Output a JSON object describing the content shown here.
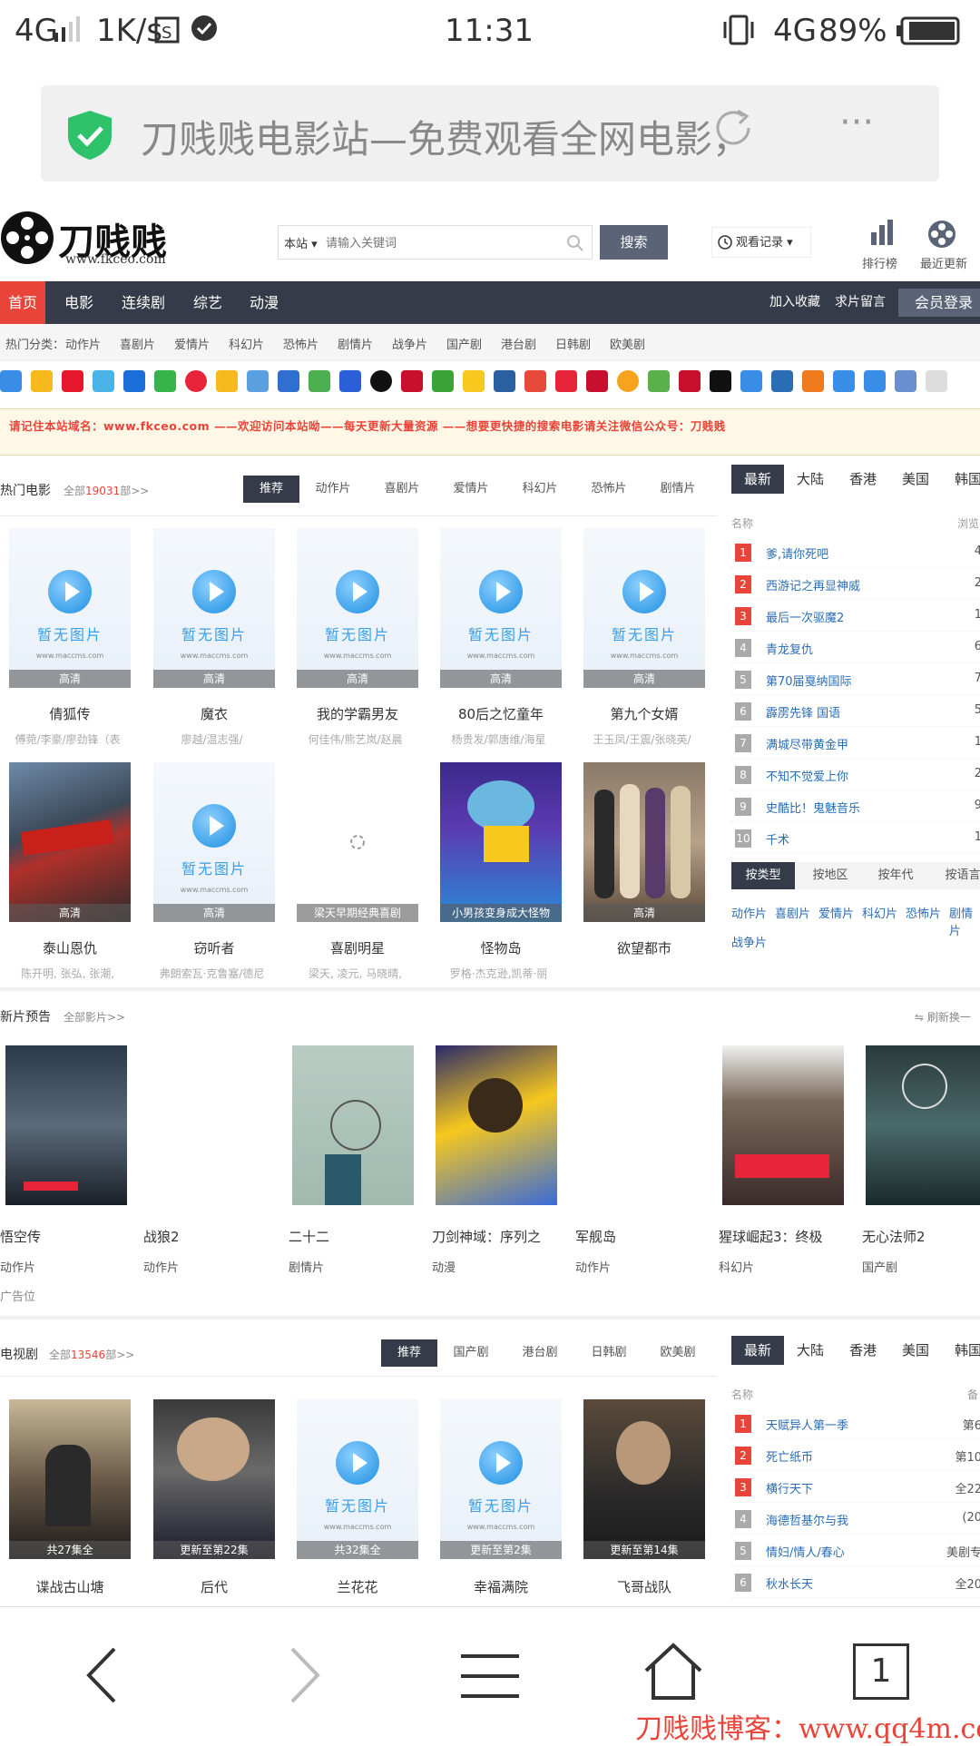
{
  "status_bar": {
    "network": "4G",
    "speed": "1K/s",
    "time": "11:31",
    "network_right": "4G",
    "battery": "89%"
  },
  "address_bar": {
    "title": "刀贱贱电影站—免费观看全网电影，",
    "more": "···"
  },
  "header": {
    "logo_text": "刀贱贱",
    "logo_url": "www.fkceo.com",
    "search_scope": "本站",
    "search_placeholder": "请输入关键词",
    "search_button": "搜索",
    "history_label": "观看记录",
    "rank_label": "排行榜",
    "recent_label": "最近更新"
  },
  "nav": {
    "items": [
      "首页",
      "电影",
      "连续剧",
      "综艺",
      "动漫"
    ],
    "active": 0,
    "right": [
      "加入收藏",
      "求片留言"
    ],
    "login": "会员登录"
  },
  "hot_categories": {
    "label": "热门分类：",
    "items": [
      "动作片",
      "喜剧片",
      "爱情片",
      "科幻片",
      "恐怖片",
      "剧情片",
      "战争片",
      "国产剧",
      "港台剧",
      "日韩剧",
      "欧美剧"
    ]
  },
  "notice": "请记住本站域名：www.fkceo.com ——欢迎访问本站呦——每天更新大量资源 ——想要更快捷的搜索电影请关注微信公众号：刀贱贱",
  "hot_movies": {
    "title": "热门电影",
    "count_prefix": "全部",
    "count": "19031",
    "count_suffix": "部>>",
    "tabs": [
      "推荐",
      "动作片",
      "喜剧片",
      "爱情片",
      "科幻片",
      "恐怖片",
      "剧情片"
    ],
    "no_image_text": "暂无图片",
    "watermark": "www.maccms.com",
    "movies": [
      {
        "title": "倩狐传",
        "cast": "傅菀/李豪/廖劲锋（表",
        "badge": "高清",
        "poster": "none"
      },
      {
        "title": "魔衣",
        "cast": "廖越/温志强/",
        "badge": "高清",
        "poster": "none"
      },
      {
        "title": "我的学霸男友",
        "cast": "何佳伟/熊艺岚/赵晨",
        "badge": "高清",
        "poster": "none"
      },
      {
        "title": "80后之忆童年",
        "cast": "杨贵发/郭唐维/海星",
        "badge": "高清",
        "poster": "none"
      },
      {
        "title": "第九个女婿",
        "cast": "王玉凤/王震/张晓英/",
        "badge": "高清",
        "poster": "none"
      },
      {
        "title": "泰山恩仇",
        "cast": "陈开明, 张弘, 张潮,",
        "badge": "高清",
        "poster": "taishan"
      },
      {
        "title": "窃听者",
        "cast": "弗朗索瓦·克鲁塞/德尼",
        "badge": "高清",
        "poster": "none"
      },
      {
        "title": "喜剧明星",
        "cast": "梁天, 凌元, 马晓晴,",
        "badge": "梁天早期经典喜剧",
        "poster": "loading"
      },
      {
        "title": "怪物岛",
        "cast": "罗格·杰克逊,凯蒂·丽",
        "badge": "小男孩变身成大怪物",
        "poster": "monster"
      },
      {
        "title": "欲望都市",
        "cast": "",
        "badge": "高清",
        "poster": "city"
      }
    ]
  },
  "ranking": {
    "tabs": [
      "最新",
      "大陆",
      "香港",
      "美国",
      "韩国"
    ],
    "col_name": "名称",
    "col_value": "浏览",
    "items": [
      {
        "name": "爹,请你死吧",
        "value": "4"
      },
      {
        "name": "西游记之再显神威",
        "value": "2"
      },
      {
        "name": "最后一次驱魔2",
        "value": "1"
      },
      {
        "name": "青龙复仇",
        "value": "6"
      },
      {
        "name": "第70届戛纳国际",
        "value": "7"
      },
      {
        "name": "霹雳先锋 国语",
        "value": "5"
      },
      {
        "name": "满城尽带黄金甲",
        "value": "1"
      },
      {
        "name": "不知不觉爱上你",
        "value": "2"
      },
      {
        "name": "史酷比！鬼魅音乐",
        "value": "9"
      },
      {
        "name": "千术",
        "value": "1"
      }
    ],
    "filter_tabs": [
      "按类型",
      "按地区",
      "按年代",
      "按语言"
    ],
    "filter_links": [
      "动作片",
      "喜剧片",
      "爱情片",
      "科幻片",
      "恐怖片",
      "剧情片",
      "战争片"
    ]
  },
  "trailers": {
    "title": "新片预告",
    "all": "全部影片>>",
    "refresh": "刷新换一",
    "items": [
      {
        "title": "悟空传",
        "genre": "动作片",
        "poster": "wukong"
      },
      {
        "title": "战狼2",
        "genre": "动作片",
        "poster": "blank"
      },
      {
        "title": "二十二",
        "genre": "剧情片",
        "poster": "ershier"
      },
      {
        "title": "刀剑神域：序列之",
        "genre": "动漫",
        "poster": "sao"
      },
      {
        "title": "军舰岛",
        "genre": "动作片",
        "poster": "blank"
      },
      {
        "title": "猩球崛起3：终极",
        "genre": "科幻片",
        "poster": "ape"
      },
      {
        "title": "无心法师2",
        "genre": "国产剧",
        "poster": "wuxin"
      }
    ],
    "ad": "广告位"
  },
  "tv": {
    "title": "电视剧",
    "count_prefix": "全部",
    "count": "13546",
    "count_suffix": "部>>",
    "tabs": [
      "推荐",
      "国产剧",
      "港台剧",
      "日韩剧",
      "欧美剧"
    ],
    "shows": [
      {
        "title": "谍战古山塘",
        "badge": "共27集全",
        "poster": "diezhan"
      },
      {
        "title": "后代",
        "badge": "更新至第22集",
        "poster": "houdai"
      },
      {
        "title": "兰花花",
        "badge": "共32集全",
        "poster": "none"
      },
      {
        "title": "幸福满院",
        "badge": "更新至第2集",
        "poster": "none"
      },
      {
        "title": "飞哥战队",
        "badge": "更新至第14集",
        "poster": "feige"
      }
    ]
  },
  "tv_ranking": {
    "tabs": [
      "最新",
      "大陆",
      "香港",
      "美国",
      "韩国"
    ],
    "col_name": "名称",
    "col_value": "备",
    "items": [
      {
        "name": "天赋异人第一季",
        "value": "第6"
      },
      {
        "name": "死亡纸币",
        "value": "第10"
      },
      {
        "name": "横行天下",
        "value": "全22"
      },
      {
        "name": "海德哲基尔与我",
        "value": "(20"
      },
      {
        "name": "情妇/情人/春心",
        "value": "美剧专"
      },
      {
        "name": "秋水长天",
        "value": "全20"
      }
    ]
  },
  "bottom_bar": {
    "tab_count": "1"
  },
  "watermark": "刀贱贱博客：www.qq4m.com"
}
